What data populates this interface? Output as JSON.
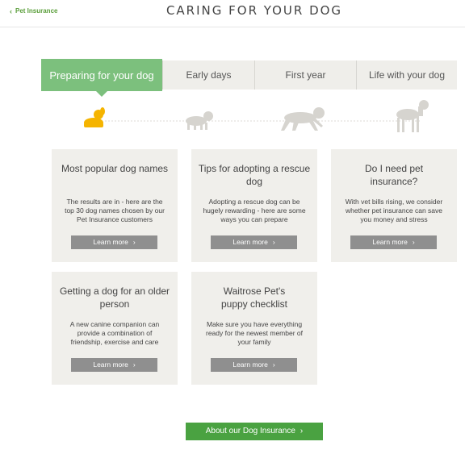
{
  "header": {
    "back_label": "Pet Insurance",
    "title": "CARING FOR YOUR DOG"
  },
  "tabs": [
    {
      "label": "Preparing for your dog",
      "active": true
    },
    {
      "label": "Early days",
      "active": false
    },
    {
      "label": "First year",
      "active": false
    },
    {
      "label": "Life with your dog",
      "active": false
    }
  ],
  "timeline": {
    "active_color": "#f5b400",
    "inactive_color": "#d6d4cf"
  },
  "cards": [
    {
      "title": "Most popular dog names",
      "body": "The results are in - here are the top 30 dog names chosen by our Pet Insurance customers",
      "button": "Learn more"
    },
    {
      "title": "Tips for adopting a rescue dog",
      "body": "Adopting a rescue dog can be hugely rewarding - here are some ways you can prepare",
      "button": "Learn more"
    },
    {
      "title": "Do I need pet insurance?",
      "body": "With vet bills rising, we consider whether pet insurance can save you money and stress",
      "button": "Learn more"
    },
    {
      "title": "Getting a dog for an older person",
      "body": "A new canine companion can provide a combination of friendship, exercise and care",
      "button": "Learn more"
    },
    {
      "title": "Waitrose Pet's puppy checklist",
      "body": "Make sure you have everything ready for the newest member of your family",
      "button": "Learn more"
    }
  ],
  "cta": {
    "label": "About our Dog Insurance"
  },
  "colors": {
    "brand_green": "#4aa241",
    "tab_active": "#7cc07d",
    "card_bg": "#f0efeb",
    "button_grey": "#8f8f8f"
  },
  "icons": {
    "back": "chevron-left-icon",
    "arrow": "chevron-right-icon"
  }
}
